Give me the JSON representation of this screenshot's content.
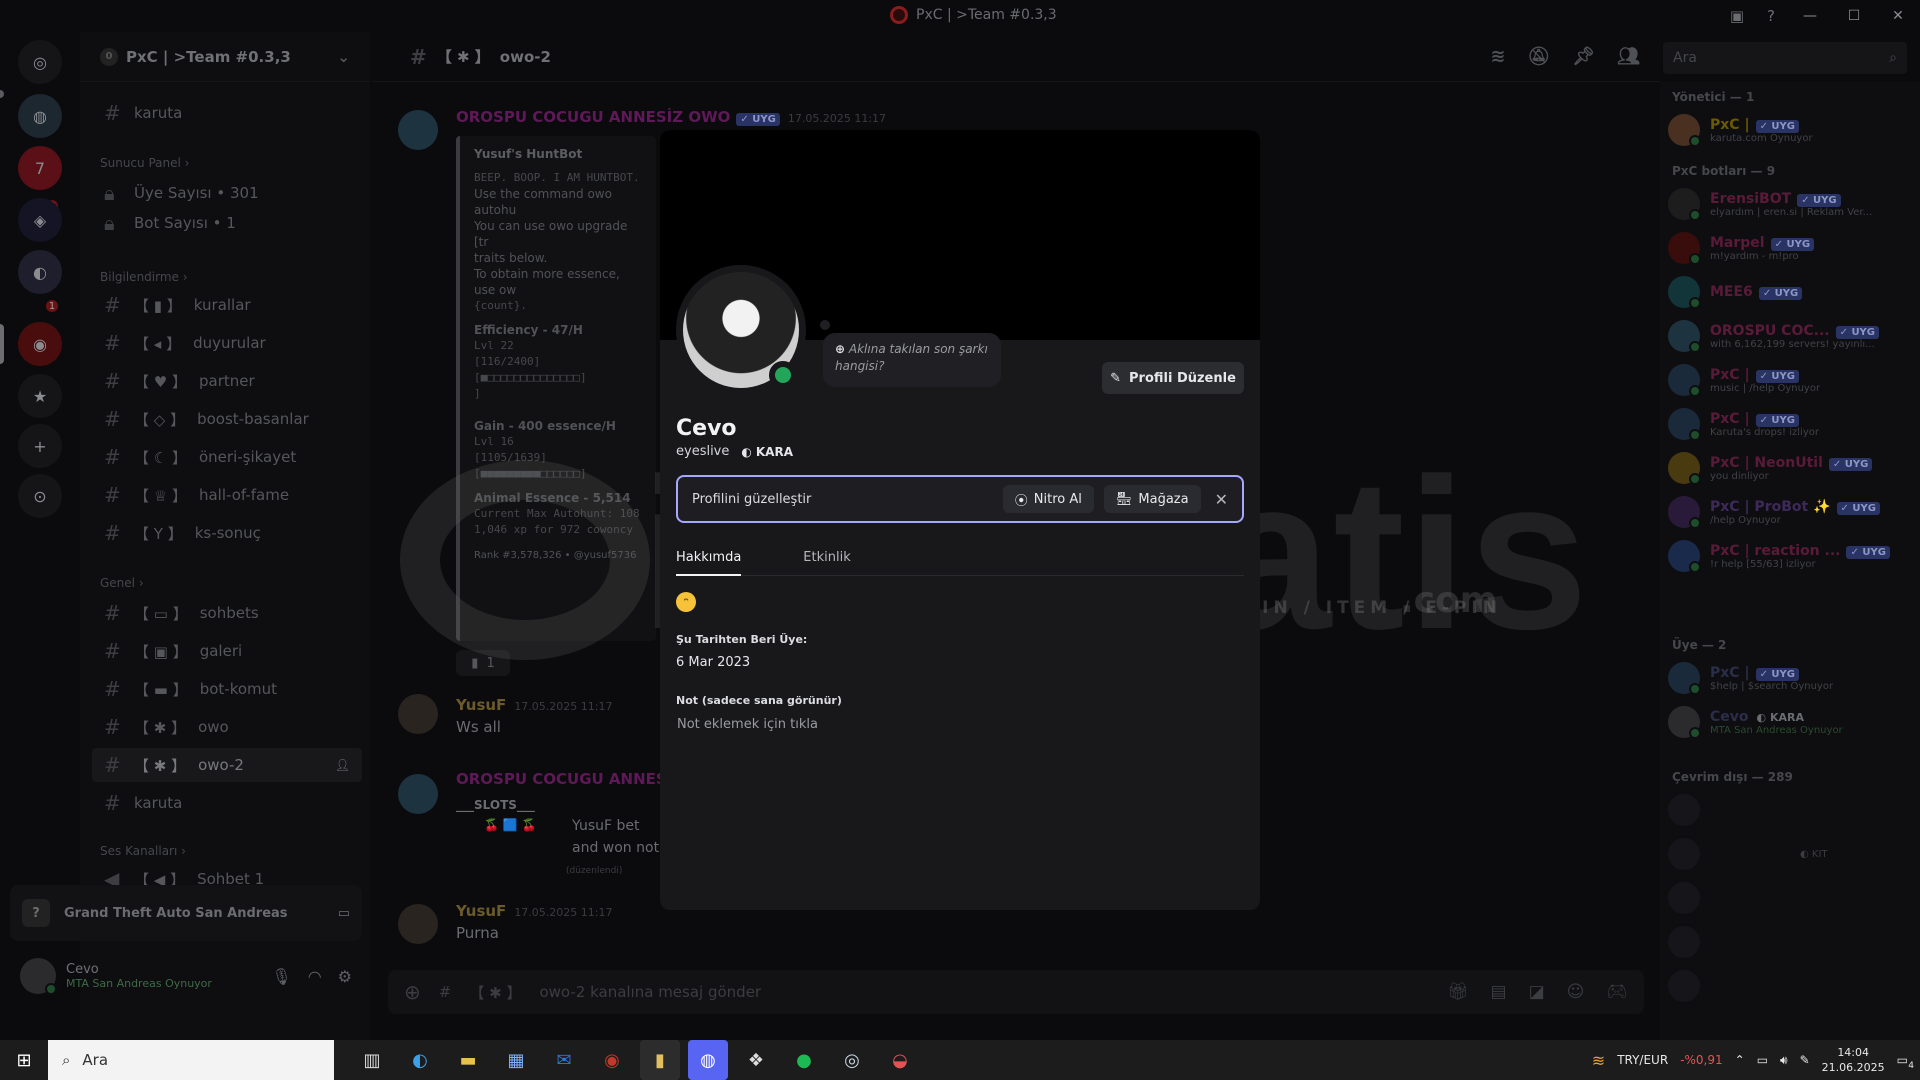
{
  "window": {
    "title": "PxC | >Team #0.3,3"
  },
  "server": {
    "name": "PxC | >Team #0.3,3",
    "member_badge": "0"
  },
  "rail": {
    "badges": [
      "3",
      "1"
    ]
  },
  "channels": {
    "top": "karuta",
    "cat_panel": "Sunucu Panel",
    "uye_sayisi": "Üye Sayısı • 301",
    "bot_sayisi": "Bot Sayısı • 1",
    "cat_bilgi": "Bilgilendirme",
    "kurallar": "kurallar",
    "duyurular": "duyurular",
    "partner": "partner",
    "boost": "boost-basanlar",
    "oneri": "öneri-şikayet",
    "hof": "hall-of-fame",
    "ks": "ks-sonuç",
    "cat_genel": "Genel",
    "sohbets": "sohbets",
    "galeri": "galeri",
    "botkomut": "bot-komut",
    "owo": "owo",
    "owo2": "owo-2",
    "karuta2": "karuta",
    "cat_ses": "Ses Kanalları",
    "sohbet1": "Sohbet 1"
  },
  "activity": {
    "game": "Grand Theft Auto San Andreas"
  },
  "user": {
    "name": "Cevo",
    "status": "MTA San Andreas Oynuyor"
  },
  "chat_header": {
    "channel": "owo-2",
    "search_placeholder": "Ara"
  },
  "messages": {
    "m1": {
      "author": "OROSPU COCUGU ANNESİZ OWO",
      "tag": "✓ UYG",
      "time": "17.05.2025 11:17"
    },
    "embed": {
      "title": "Yusuf's HuntBot",
      "line1": "BEEP. BOOP. I AM HUNTBOT.",
      "line2": "Use the command owo autohu",
      "line3": "You can use owo upgrade [tr",
      "line4": "traits below.",
      "line5": "To obtain more essence, use ow",
      "line6": "{count}.",
      "eff": "Efficiency - 47/H",
      "eff_lvl": "Lvl 22",
      "eff_prog": "[116/2400]",
      "gain": "Gain - 400 essence/H",
      "gain_lvl": "Lvl 16",
      "gain_prog": "[1105/1639]",
      "essence": "Animal Essence - 5,514",
      "current": "Current Max Autohunt: 108",
      "xp": "1,046 xp for 972 cowoncy",
      "rank": "Rank #3,578,326 • @yusuf5736"
    },
    "reaction_count": "1",
    "m2": {
      "author": "YusuF",
      "time": "17.05.2025 11:17",
      "text": "Ws all"
    },
    "m3": {
      "author": "OROSPU COCUGU ANNESİZ",
      "slots": "___SLOTS___",
      "bet": "YusuF bet",
      "won": "and won noth",
      "edited": "(düzenlendi)"
    },
    "m4": {
      "author": "YusuF",
      "time": "17.05.2025 11:17",
      "text": "Purna"
    }
  },
  "input": {
    "placeholder": "owo-2 kanalına mesaj gönder"
  },
  "members": {
    "cat_admin": "Yönetici — 1",
    "admin": {
      "name": "PxC |",
      "tag": "✓ UYG",
      "status": "karuta.com Oynuyor"
    },
    "cat_bots": "PxC botları — 9",
    "bots": [
      {
        "name": "ErensiBOT",
        "tag": "✓ UYG",
        "status": "elyardım | eren.si | Reklam Ver..."
      },
      {
        "name": "Marpel",
        "tag": "✓ UYG",
        "status": "m!yardım - m!pro"
      },
      {
        "name": "MEE6",
        "tag": "✓ UYG",
        "status": ""
      },
      {
        "name": "OROSPU COC...",
        "tag": "✓ UYG",
        "status": "with 6,162,199 servers! yayınlı..."
      },
      {
        "name": "PxC |",
        "tag": "✓ UYG",
        "status": "music | /help Oynuyor"
      },
      {
        "name": "PxC |",
        "tag": "✓ UYG",
        "status": "Karuta's drops! izliyor"
      },
      {
        "name": "PxC | NeonUtil",
        "tag": "✓ UYG",
        "status": "you dinliyor"
      },
      {
        "name": "PxC | ProBot ✨",
        "tag": "✓ UYG",
        "status": "/help Oynuyor"
      },
      {
        "name": "PxC | reaction ...",
        "tag": "✓ UYG",
        "status": "!r help [55/63] izliyor"
      }
    ],
    "cat_uye": "Üye — 2",
    "uye": [
      {
        "name": "PxC |",
        "tag": "✓ UYG",
        "status": "$help | $search Oynuyor"
      },
      {
        "name": "Cevo",
        "tag": "KARA",
        "status": "MTA San Andreas Oynuyor"
      }
    ],
    "cat_offline": "Çevrim dışı — 289",
    "offline_tag": "KIT"
  },
  "watermark": {
    "brand": "itemsatis",
    "sub": "HESAP / SKIN / ITEM / E-PIN",
    "dom": ".com"
  },
  "profile": {
    "song_prompt": "Aklına takılan son şarkı hangisi?",
    "edit_button": "Profili Düzenle",
    "display_name": "Cevo",
    "username": "eyeslive",
    "clan": "KARA",
    "nitro_text": "Profilini güzelleştir",
    "nitro_button": "Nitro Al",
    "shop_button": "Mağaza",
    "tab_about": "Hakkımda",
    "tab_activity": "Etkinlik",
    "member_since_label": "Şu Tarihten Beri Üye:",
    "member_since": "6 Mar 2023",
    "note_label": "Not (sadece sana görünür)",
    "note_placeholder": "Not eklemek için tıkla"
  },
  "taskbar": {
    "search": "Ara",
    "currency": "TRY/EUR",
    "change": "-%0,91",
    "time": "14:04",
    "date": "21.06.2025",
    "notif": "4"
  }
}
